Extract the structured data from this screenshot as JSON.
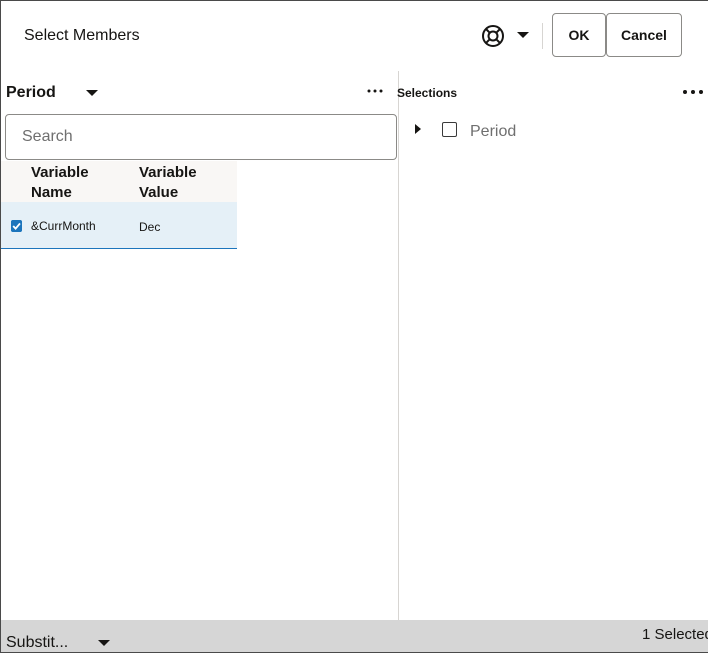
{
  "dialog": {
    "title": "Select Members",
    "ok_label": "OK",
    "cancel_label": "Cancel",
    "help_icon": "lifebuoy-icon"
  },
  "left_panel": {
    "dimension": "Period",
    "search": {
      "placeholder": "Search",
      "value": ""
    },
    "table": {
      "columns": [
        "Variable\nName",
        "Variable\nValue"
      ],
      "rows": [
        {
          "name": "&CurrMonth",
          "value": "Dec",
          "checked": true
        }
      ]
    }
  },
  "right_panel": {
    "title": "Selections",
    "tree": [
      {
        "label": "Period",
        "checked": false,
        "expanded": false
      }
    ]
  },
  "footer": {
    "filter_label": "Substit...",
    "count_text": "1 Selected"
  },
  "colors": {
    "accent": "#1c75bc",
    "selected_row": "#e5f0f7",
    "footer_bg": "#d6d6d6"
  }
}
